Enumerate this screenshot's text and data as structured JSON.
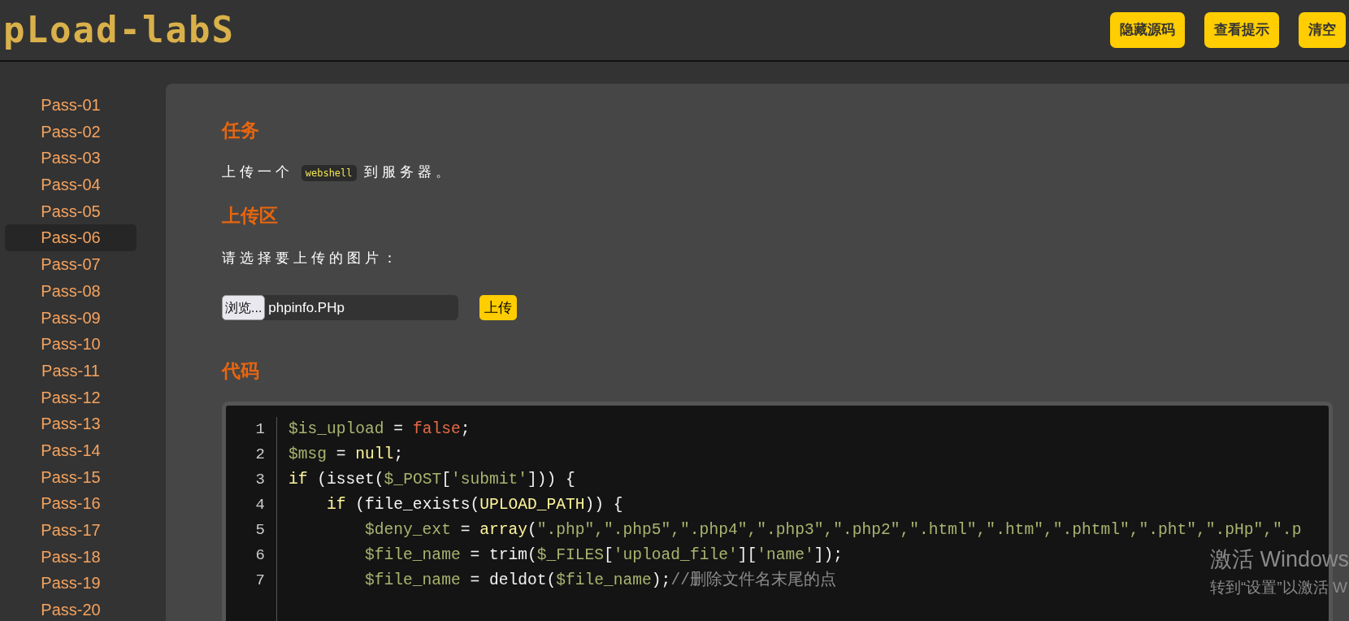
{
  "header": {
    "logo": "pLoad-labS",
    "buttons": [
      "隐藏源码",
      "查看提示",
      "清空"
    ]
  },
  "sidebar": {
    "items": [
      {
        "label": "Pass-01",
        "selected": false
      },
      {
        "label": "Pass-02",
        "selected": false
      },
      {
        "label": "Pass-03",
        "selected": false
      },
      {
        "label": "Pass-04",
        "selected": false
      },
      {
        "label": "Pass-05",
        "selected": false
      },
      {
        "label": "Pass-06",
        "selected": true
      },
      {
        "label": "Pass-07",
        "selected": false
      },
      {
        "label": "Pass-08",
        "selected": false
      },
      {
        "label": "Pass-09",
        "selected": false
      },
      {
        "label": "Pass-10",
        "selected": false
      },
      {
        "label": "Pass-11",
        "selected": false
      },
      {
        "label": "Pass-12",
        "selected": false
      },
      {
        "label": "Pass-13",
        "selected": false
      },
      {
        "label": "Pass-14",
        "selected": false
      },
      {
        "label": "Pass-15",
        "selected": false
      },
      {
        "label": "Pass-16",
        "selected": false
      },
      {
        "label": "Pass-17",
        "selected": false
      },
      {
        "label": "Pass-18",
        "selected": false
      },
      {
        "label": "Pass-19",
        "selected": false
      },
      {
        "label": "Pass-20",
        "selected": false
      }
    ]
  },
  "task": {
    "heading": "任务",
    "text_before": "上传一个",
    "code": "webshell",
    "text_after": "到服务器。"
  },
  "upload": {
    "heading": "上传区",
    "prompt": "请选择要上传的图片：",
    "browse_button": "浏览...",
    "file_name": "phpinfo.PHp",
    "submit_button": "上传"
  },
  "code": {
    "heading": "代码",
    "lines": [
      {
        "number": "1",
        "tokens": [
          {
            "kind": "var",
            "text": "$is_upload"
          },
          {
            "kind": "plain",
            "text": " = "
          },
          {
            "kind": "bool",
            "text": "false"
          },
          {
            "kind": "plain",
            "text": ";"
          }
        ]
      },
      {
        "number": "2",
        "tokens": [
          {
            "kind": "var",
            "text": "$msg"
          },
          {
            "kind": "plain",
            "text": " = "
          },
          {
            "kind": "keyword",
            "text": "null"
          },
          {
            "kind": "plain",
            "text": ";"
          }
        ]
      },
      {
        "number": "3",
        "tokens": [
          {
            "kind": "keyword",
            "text": "if"
          },
          {
            "kind": "plain",
            "text": " (isset("
          },
          {
            "kind": "var",
            "text": "$_POST"
          },
          {
            "kind": "plain",
            "text": "["
          },
          {
            "kind": "string",
            "text": "'submit'"
          },
          {
            "kind": "plain",
            "text": "])) {"
          }
        ]
      },
      {
        "number": "4",
        "tokens": [
          {
            "kind": "keyword",
            "text": "    if"
          },
          {
            "kind": "plain",
            "text": " (file_exists("
          },
          {
            "kind": "keyword",
            "text": "UPLOAD_PATH"
          },
          {
            "kind": "plain",
            "text": ")) {"
          }
        ]
      },
      {
        "number": "5",
        "tokens": [
          {
            "kind": "var",
            "text": "        $deny_ext"
          },
          {
            "kind": "plain",
            "text": " = "
          },
          {
            "kind": "keyword",
            "text": "array"
          },
          {
            "kind": "plain",
            "text": "("
          },
          {
            "kind": "string",
            "text": "\".php\",\".php5\",\".php4\",\".php3\",\".php2\",\".html\",\".htm\",\".phtml\",\".pht\",\".pHp\",\".p"
          }
        ]
      },
      {
        "number": "6",
        "tokens": [
          {
            "kind": "var",
            "text": "        $file_name"
          },
          {
            "kind": "plain",
            "text": " = trim("
          },
          {
            "kind": "var",
            "text": "$_FILES"
          },
          {
            "kind": "plain",
            "text": "["
          },
          {
            "kind": "string",
            "text": "'upload_file'"
          },
          {
            "kind": "plain",
            "text": "]["
          },
          {
            "kind": "string",
            "text": "'name'"
          },
          {
            "kind": "plain",
            "text": "]);"
          }
        ]
      },
      {
        "number": "7",
        "tokens": [
          {
            "kind": "var",
            "text": "        $file_name"
          },
          {
            "kind": "plain",
            "text": " = deldot("
          },
          {
            "kind": "var",
            "text": "$file_name"
          },
          {
            "kind": "plain",
            "text": ");"
          },
          {
            "kind": "comment",
            "text": "//删除文件名末尾的点"
          }
        ]
      }
    ]
  },
  "os_notice": {
    "title": "激活 Windows",
    "text": "转到“设置”以激活 W"
  }
}
